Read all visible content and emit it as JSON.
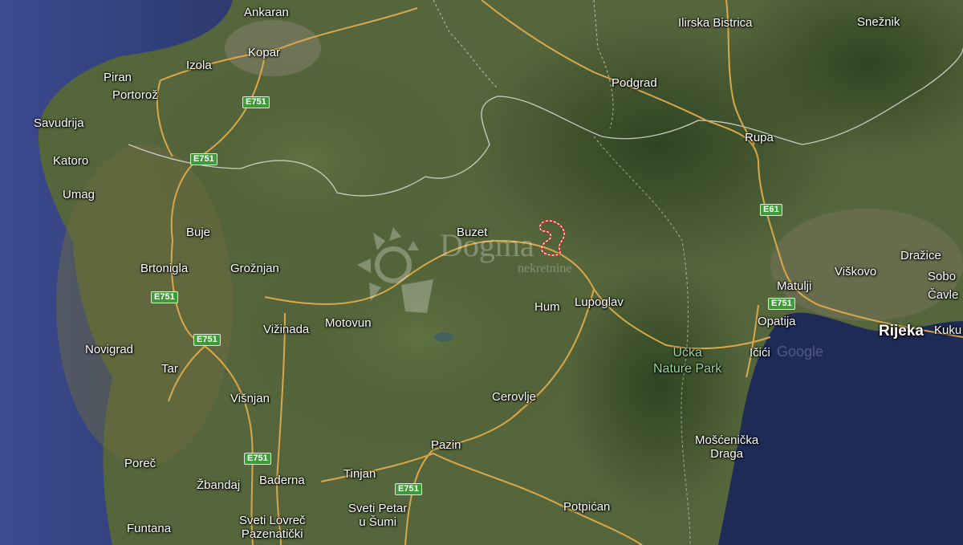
{
  "places": [
    {
      "id": "ankaran",
      "name": "Ankaran"
    },
    {
      "id": "kopar",
      "name": "Kopar"
    },
    {
      "id": "izola",
      "name": "Izola"
    },
    {
      "id": "piran",
      "name": "Piran"
    },
    {
      "id": "portoroz",
      "name": "Portorož"
    },
    {
      "id": "savudrija",
      "name": "Savudrija"
    },
    {
      "id": "katoro",
      "name": "Katoro"
    },
    {
      "id": "umag",
      "name": "Umag"
    },
    {
      "id": "buje",
      "name": "Buje"
    },
    {
      "id": "brtonigla",
      "name": "Brtonigla"
    },
    {
      "id": "groznjan",
      "name": "Grožnjan"
    },
    {
      "id": "novigrad",
      "name": "Novigrad"
    },
    {
      "id": "tar",
      "name": "Tar"
    },
    {
      "id": "vizinada",
      "name": "Vižinada"
    },
    {
      "id": "motovun",
      "name": "Motovun"
    },
    {
      "id": "visnjan",
      "name": "Višnjan"
    },
    {
      "id": "porec",
      "name": "Poreč"
    },
    {
      "id": "zbandaj",
      "name": "Žbandaj"
    },
    {
      "id": "baderna",
      "name": "Baderna"
    },
    {
      "id": "tinjan",
      "name": "Tinjan"
    },
    {
      "id": "funtana",
      "name": "Funtana"
    },
    {
      "id": "sveti-lovrec",
      "name": "Sveti Lovreč\nPazenatički"
    },
    {
      "id": "sveti-petar",
      "name": "Sveti Petar\nu Šumi"
    },
    {
      "id": "pazin",
      "name": "Pazin"
    },
    {
      "id": "cerovlje",
      "name": "Cerovlje"
    },
    {
      "id": "hum",
      "name": "Hum"
    },
    {
      "id": "lupoglav",
      "name": "Lupoglav"
    },
    {
      "id": "buzet",
      "name": "Buzet"
    },
    {
      "id": "podgrad",
      "name": "Podgrad"
    },
    {
      "id": "ilirska-bistrica",
      "name": "Ilirska Bistrica"
    },
    {
      "id": "sneznik",
      "name": "Snežnik"
    },
    {
      "id": "rupa",
      "name": "Rupa"
    },
    {
      "id": "matulji",
      "name": "Matulji"
    },
    {
      "id": "viskovo",
      "name": "Viškovo"
    },
    {
      "id": "drazice",
      "name": "Dražice"
    },
    {
      "id": "sobo",
      "name": "Sobo"
    },
    {
      "id": "cavle",
      "name": "Čavle"
    },
    {
      "id": "opatija",
      "name": "Opatija"
    },
    {
      "id": "icici",
      "name": "Ičići"
    },
    {
      "id": "rijeka",
      "name": "Rijeka"
    },
    {
      "id": "kuku",
      "name": "Kuku"
    },
    {
      "id": "moscenicka",
      "name": "Mošćenička\nDraga"
    },
    {
      "id": "potpican",
      "name": "Potpićan"
    },
    {
      "id": "ucka",
      "name": "Učka\nNature Park"
    }
  ],
  "road_shields": [
    "E751",
    "E751",
    "E751",
    "E751",
    "E751",
    "E751",
    "E61",
    "E751"
  ],
  "watermark": {
    "brand": "Dogma",
    "sub": "nekretnine"
  },
  "google_mark": "Google",
  "colors": {
    "sea": "#2b3a6e",
    "sea_deep": "#1f2d5a",
    "land": "#4d5f37",
    "road": "#d9a84a",
    "border": "#e8e8e8",
    "marker": "#e02020"
  }
}
